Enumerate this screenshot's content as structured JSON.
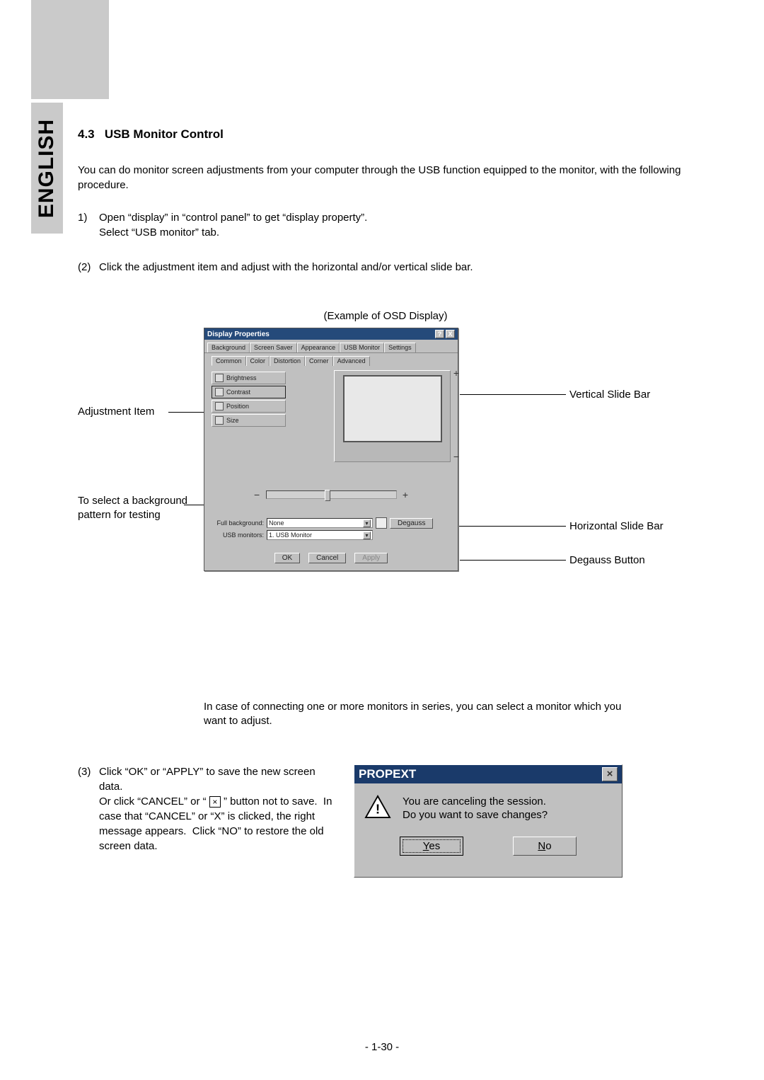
{
  "language_tab": "ENGLISH",
  "section": {
    "number": "4.3",
    "title": "USB Monitor Control"
  },
  "intro": "You can do monitor screen adjustments from your computer through the USB function equipped to the monitor, with the following procedure.",
  "steps": {
    "s1_num": "1)",
    "s1a": "Open “display” in “control panel” to get “display property”.",
    "s1b": "Select “USB monitor” tab.",
    "s2_num": "(2)",
    "s2": "Click the adjustment item and adjust with the horizontal and/or vertical slide bar.",
    "s3_num": "(3)",
    "s3": "Click “OK” or “APPLY” to save the new screen data.\nOr click “CANCEL” or “ × ” button not to save.  In case that “CANCEL” or “X” is clicked, the right message appears.  Click “NO” to restore the old screen data."
  },
  "example_caption": "(Example of OSD Display)",
  "annotations": {
    "adjustment_item": "Adjustment Item",
    "bg_select": "To select a background pattern for testing",
    "vslide": "Vertical Slide Bar",
    "hslide": "Horizontal Slide Bar",
    "degauss": "Degauss Button"
  },
  "dlg": {
    "title": "Display Properties",
    "help_btn": "?",
    "close_btn": "X",
    "tabs": [
      "Background",
      "Screen Saver",
      "Appearance",
      "USB Monitor",
      "Settings"
    ],
    "subtabs": [
      "Common",
      "Color",
      "Distortion",
      "Corner",
      "Advanced"
    ],
    "items": [
      "Brightness",
      "Contrast",
      "Position",
      "Size"
    ],
    "full_bg_label": "Full background:",
    "full_bg_value": "None",
    "usb_mon_label": "USB monitors:",
    "usb_mon_value": "1. USB Monitor",
    "degauss_btn": "Degauss",
    "ok": "OK",
    "cancel": "Cancel",
    "apply": "Apply"
  },
  "series_note": "In case of connecting one or more monitors in series, you can select a monitor which you want to adjust.",
  "propext": {
    "title": "PROPEXT",
    "line1": "You are canceling the session.",
    "line2": "Do you want to save changes?",
    "yes": "Yes",
    "no": "No"
  },
  "page_number": "- 1-30 -"
}
